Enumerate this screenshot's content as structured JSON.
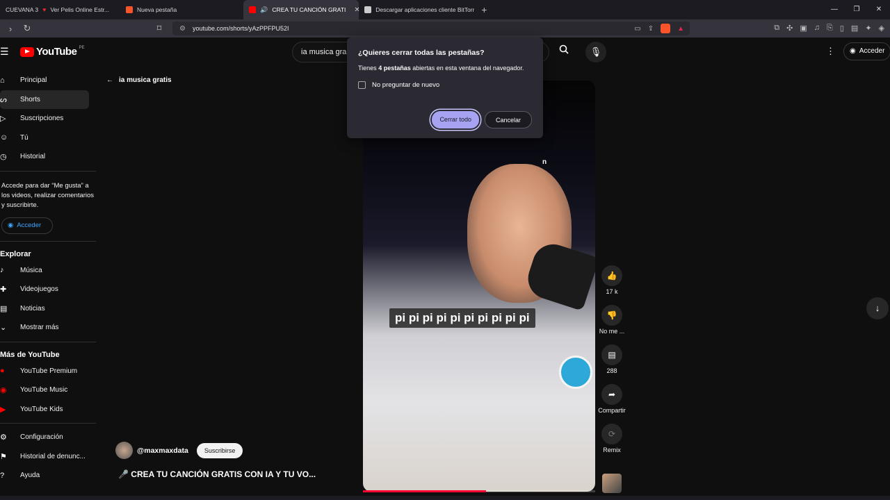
{
  "browser": {
    "tabs": [
      {
        "label": "CUEVANA 3",
        "favicon_color": "#e02b2b",
        "extra": "Ver Pelis Online Estr..."
      },
      {
        "label": "Nueva pestaña",
        "favicon_color": "#fb542b"
      },
      {
        "label": "CREA TU CANCIÓN GRATI",
        "favicon_color": "#ff0000",
        "active": true
      },
      {
        "label": "Descargar aplicaciones cliente BitTorr",
        "favicon_color": "#cccccc"
      }
    ],
    "url": "youtube.com/shorts/yAzPPFPU52I"
  },
  "youtube": {
    "region": "PE",
    "search_value": "ia musica gra",
    "signin_label": "Acceder",
    "sidebar": {
      "main": [
        {
          "label": "Principal",
          "icon": "home-icon"
        },
        {
          "label": "Shorts",
          "icon": "shorts-icon",
          "selected": true
        },
        {
          "label": "Suscripciones",
          "icon": "subscriptions-icon"
        },
        {
          "label": "Tú",
          "icon": "you-icon"
        },
        {
          "label": "Historial",
          "icon": "history-icon"
        }
      ],
      "signin_prompt": "Accede para dar “Me gusta” a los videos, realizar comentarios y suscribirte.",
      "signin_button": "Acceder",
      "explore_title": "Explorar",
      "explore": [
        {
          "label": "Música",
          "icon": "music-icon"
        },
        {
          "label": "Videojuegos",
          "icon": "gaming-icon"
        },
        {
          "label": "Noticias",
          "icon": "news-icon"
        },
        {
          "label": "Mostrar más",
          "icon": "chevron-down-icon"
        }
      ],
      "more_title": "Más de YouTube",
      "more": [
        {
          "label": "YouTube Premium"
        },
        {
          "label": "YouTube Music"
        },
        {
          "label": "YouTube Kids"
        }
      ],
      "settings": [
        {
          "label": "Configuración",
          "icon": "gear-icon"
        },
        {
          "label": "Historial de denunc...",
          "icon": "flag-icon"
        },
        {
          "label": "Ayuda",
          "icon": "help-icon"
        }
      ]
    },
    "back_label": "ia musica gratis",
    "short": {
      "caption": "pi pi pi pi pi pi pi pi pi pi",
      "channel": "@maxmaxdata",
      "subscribe": "Suscribirse",
      "title": "🎤 CREA TU CANCIÓN GRATIS CON IA Y TU VO...",
      "progress_fraction": 0.53,
      "behind_dialog_letter": "n"
    },
    "actions": [
      {
        "icon": "like-icon",
        "label": "17 k"
      },
      {
        "icon": "dislike-icon",
        "label": "No me ..."
      },
      {
        "icon": "comment-icon",
        "label": "288"
      },
      {
        "icon": "share-icon",
        "label": "Compartir"
      },
      {
        "icon": "remix-icon",
        "label": "Remix"
      }
    ]
  },
  "dialog": {
    "title": "¿Quieres cerrar todas las pestañas?",
    "body_prefix": "Tienes",
    "body_bold": "4 pestañas",
    "body_suffix": "abiertas en esta ventana del navegador.",
    "checkbox_label": "No preguntar de nuevo",
    "confirm": "Cerrar todo",
    "cancel": "Cancelar"
  }
}
